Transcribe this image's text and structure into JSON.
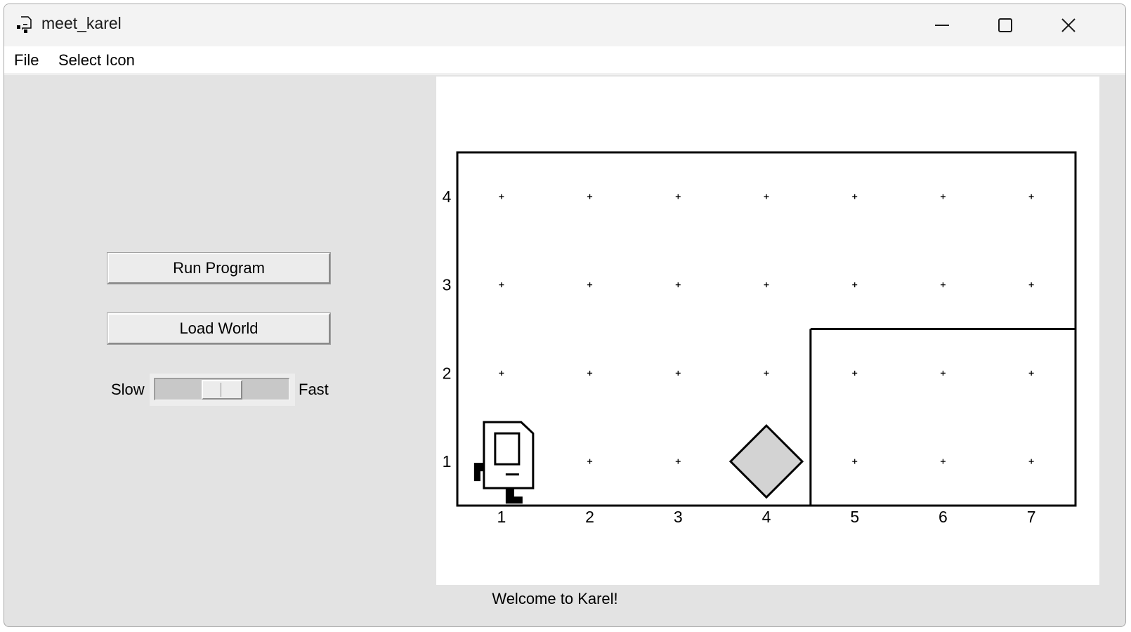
{
  "window": {
    "title": "meet_karel",
    "icon": "karel-app-icon",
    "controls": [
      "minimize-icon",
      "maximize-icon",
      "close-icon"
    ]
  },
  "menu": {
    "file": "File",
    "select_icon": "Select Icon"
  },
  "controls": {
    "run_program": "Run Program",
    "load_world": "Load World",
    "speed": {
      "slow_label": "Slow",
      "fast_label": "Fast",
      "value": 0.5
    }
  },
  "world": {
    "columns": 7,
    "rows": 4,
    "x_labels": [
      "1",
      "2",
      "3",
      "4",
      "5",
      "6",
      "7"
    ],
    "y_labels": [
      "1",
      "2",
      "3",
      "4"
    ],
    "karel": {
      "avenue": 1,
      "street": 1,
      "facing": "east"
    },
    "beepers": [
      {
        "avenue": 4,
        "street": 1
      }
    ],
    "walls": [
      {
        "from": [
          4.5,
          0.5
        ],
        "to": [
          4.5,
          2.5
        ]
      },
      {
        "from": [
          4.5,
          2.5
        ],
        "to": [
          7.5,
          2.5
        ]
      }
    ]
  },
  "status": {
    "message": "Welcome to Karel!"
  },
  "colors": {
    "panel_bg": "#e3e3e3",
    "canvas_bg": "#ffffff",
    "beeper_fill": "#d3d3d3"
  }
}
